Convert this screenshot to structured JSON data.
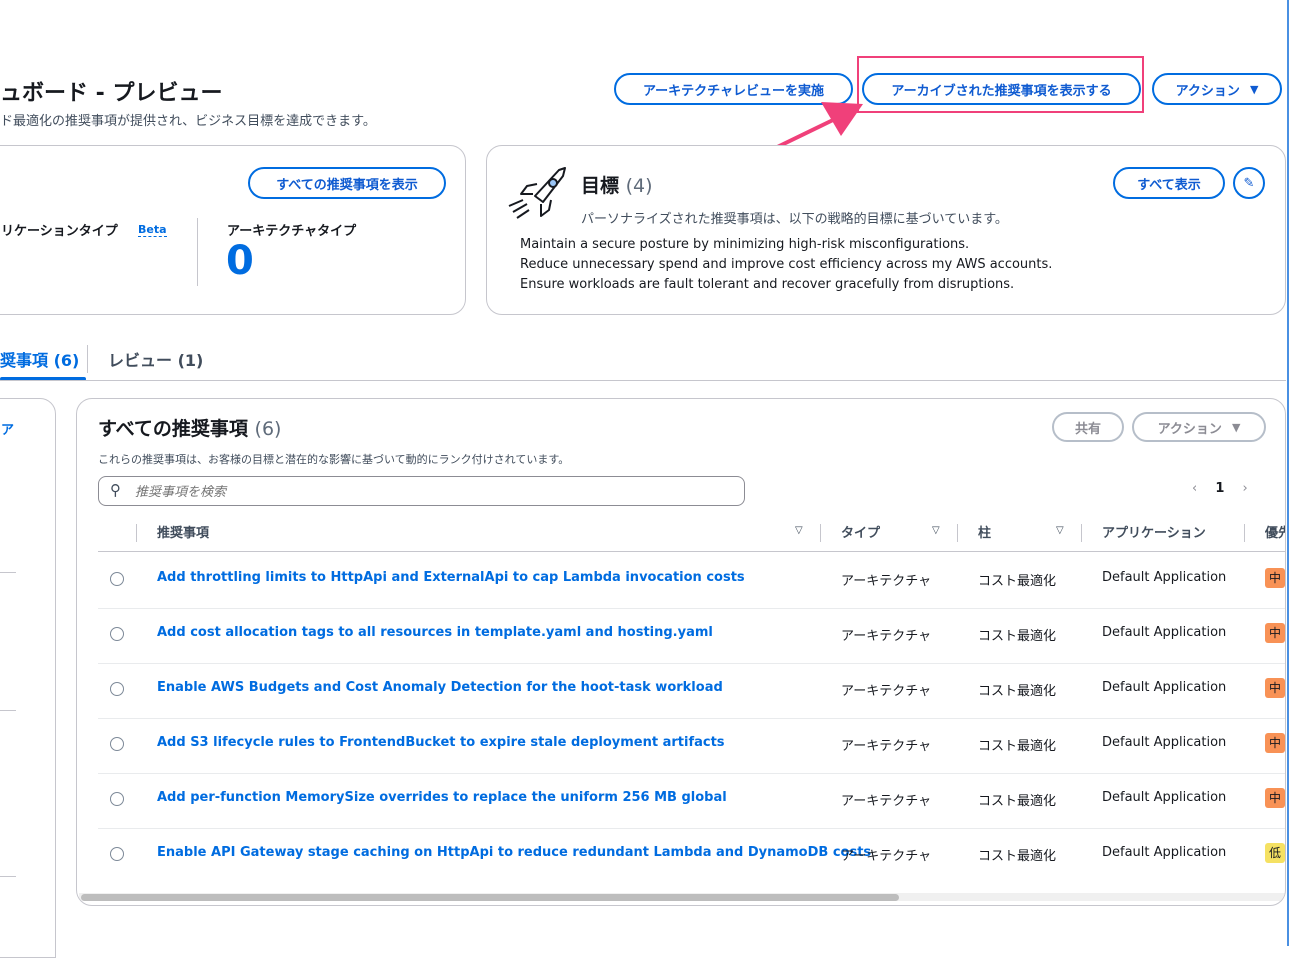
{
  "header": {
    "title": "ュボード - プレビュー",
    "subtitle": "ド最適化の推奨事項が提供され、ビジネス目標を達成できます。",
    "buttons": {
      "review": "アーキテクチャレビューを実施",
      "archived": "アーカイブされた推奨事項を表示する",
      "action": "アクション"
    }
  },
  "summary_card": {
    "view_all_button": "すべての推奨事項を表示",
    "app_type_label": "リケーションタイプ",
    "beta_badge": "Beta",
    "arch_type_label": "アーキテクチャタイプ",
    "arch_type_value": "0"
  },
  "goals_card": {
    "title": "目標",
    "count": "(4)",
    "show_all_button": "すべて表示",
    "description": "パーソナライズされた推奨事項は、以下の戦略的目標に基づいています。",
    "goals": [
      "Maintain a secure posture by minimizing high-risk misconfigurations.",
      "Reduce unnecessary spend and improve cost efficiency across my AWS accounts.",
      "Ensure workloads are fault tolerant and recover gracefully from disruptions."
    ]
  },
  "tabs": [
    {
      "label": "奨事項 (6)"
    },
    {
      "label": "レビュー (1)"
    }
  ],
  "left_panel": {
    "link_fragment": "ア"
  },
  "recommendations": {
    "title": "すべての推奨事項",
    "count": "(6)",
    "description": "これらの推奨事項は、お客様の目標と潜在的な影響に基づいて動的にランク付けされています。",
    "share_button": "共有",
    "action_button": "アクション",
    "search_placeholder": "推奨事項を検索",
    "page_number": "1",
    "columns": {
      "recommendation": "推奨事項",
      "type": "タイプ",
      "pillar": "柱",
      "application": "アプリケーション",
      "priority": "優先"
    },
    "rows": [
      {
        "title": "Add throttling limits to HttpApi and ExternalApi to cap Lambda invocation costs",
        "type": "アーキテクチャ",
        "pillar": "コスト最適化",
        "application": "Default Application",
        "priority": "中"
      },
      {
        "title": "Add cost allocation tags to all resources in template.yaml and hosting.yaml",
        "type": "アーキテクチャ",
        "pillar": "コスト最適化",
        "application": "Default Application",
        "priority": "中"
      },
      {
        "title": "Enable AWS Budgets and Cost Anomaly Detection for the hoot-task workload",
        "type": "アーキテクチャ",
        "pillar": "コスト最適化",
        "application": "Default Application",
        "priority": "中"
      },
      {
        "title": "Add S3 lifecycle rules to FrontendBucket to expire stale deployment artifacts",
        "type": "アーキテクチャ",
        "pillar": "コスト最適化",
        "application": "Default Application",
        "priority": "中"
      },
      {
        "title": "Add per-function MemorySize overrides to replace the uniform 256 MB global",
        "type": "アーキテクチャ",
        "pillar": "コスト最適化",
        "application": "Default Application",
        "priority": "中"
      },
      {
        "title": "Enable API Gateway stage caching on HttpApi to reduce redundant Lambda and DynamoDB costs",
        "type": "アーキテクチャ",
        "pillar": "コスト最適化",
        "application": "Default Application",
        "priority": "低"
      }
    ]
  },
  "colors": {
    "accent": "#006ce0",
    "highlight": "#f0407a",
    "priority_medium": "#f89256",
    "priority_low": "#f5e163"
  }
}
